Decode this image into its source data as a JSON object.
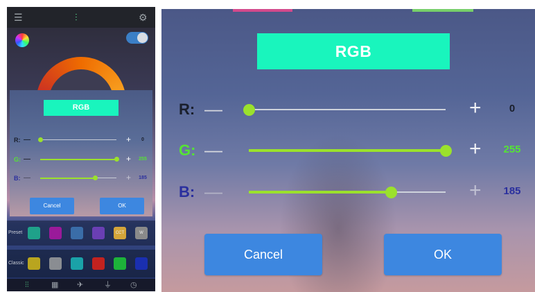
{
  "dialog": {
    "title": "RGB",
    "title_bg": "#19f5bd",
    "accent": "#9be12c",
    "channels": [
      {
        "label": "R:",
        "value": "0",
        "fraction": 0.0,
        "label_color": "#1a1f2c",
        "value_color": "#1a1f2c"
      },
      {
        "label": "G:",
        "value": "255",
        "fraction": 1.0,
        "label_color": "#55e335",
        "value_color": "#55e335"
      },
      {
        "label": "B:",
        "value": "185",
        "fraction": 0.725,
        "label_color": "#2a2f9e",
        "value_color": "#2a2f9e"
      }
    ],
    "minus_icon": "minus-icon",
    "plus_icon": "plus-icon",
    "buttons": {
      "cancel": "Cancel",
      "ok": "OK",
      "color": "#3d87e0"
    }
  },
  "phone": {
    "top_icons": [
      "list-icon",
      "equalizer-icon",
      "gear-icon"
    ],
    "preset": {
      "label": "Preset",
      "swatches": [
        {
          "color": "#1fa28a",
          "text": ""
        },
        {
          "color": "#9a1a9a",
          "text": ""
        },
        {
          "color": "#3a6da8",
          "text": ""
        },
        {
          "color": "#6a3fb4",
          "text": ""
        },
        {
          "color": "#d4a53a",
          "text": "CCT"
        },
        {
          "color": "#8a8a8a",
          "text": "W"
        }
      ]
    },
    "classic": {
      "label": "Classic",
      "swatches": [
        {
          "color": "#b9a51f"
        },
        {
          "color": "#8a8d92"
        },
        {
          "color": "#1aa2a8"
        },
        {
          "color": "#c2221f"
        },
        {
          "color": "#1db23a"
        },
        {
          "color": "#1a2fb0"
        }
      ]
    },
    "bottom_icons": [
      "sliders-icon",
      "grid-icon",
      "airplane-icon",
      "microphone-icon",
      "timer-icon"
    ]
  }
}
